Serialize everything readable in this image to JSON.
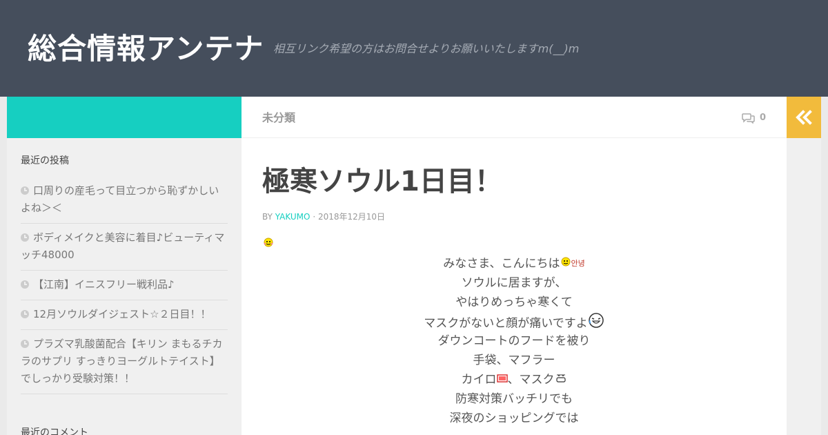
{
  "header": {
    "site_title": "総合情報アンテナ",
    "site_description": "相互リンク希望の方はお問合せよりお願いいたしますm(__)m"
  },
  "sidebar": {
    "recent_posts_title": "最近の投稿",
    "recent_posts": [
      "口周りの産毛って目立つから恥ずかしいよね＞＜",
      "ボディメイクと美容に着目♪ビューティマッチ48000",
      "【江南】イニスフリー戦利品♪",
      "12月ソウルダイジェスト☆２日目！！",
      "プラズマ乳酸菌配合【キリン まもるチカラのサプリ すっきりヨーグルトテイスト】でしっかり受験対策！！"
    ],
    "recent_comments_title": "最近のコメント"
  },
  "content_bar": {
    "category": "未分類",
    "comment_count": "0",
    "comment_icon": "speech-bubbles-icon"
  },
  "post": {
    "title": "極寒ソウル1日目！",
    "byline_prefix": "BY",
    "author": "YAKUMO",
    "separator": "·",
    "date": "2018年12月10日",
    "lines": {
      "l1": "みなさま、こんにちは",
      "l1_sticker": "안녕",
      "l2": "ソウルに居ますが、",
      "l3": "やはりめっちゃ寒くて",
      "l4": "マスクがないと顔が痛いですよ",
      "l5": "ダウンコートのフードを被り",
      "l6": "手袋、マフラー",
      "l7a": "カイロ",
      "l7b": "、マスク",
      "l8": "防寒対策バッチリでも",
      "l9": "深夜のショッピングでは"
    }
  },
  "colors": {
    "header_bg": "#454e5c",
    "accent_teal": "#16cfc1",
    "collapse_button": "#f2bb3c",
    "content_bg": "#ffffff",
    "sidebar_bg": "#f0f0f0"
  }
}
